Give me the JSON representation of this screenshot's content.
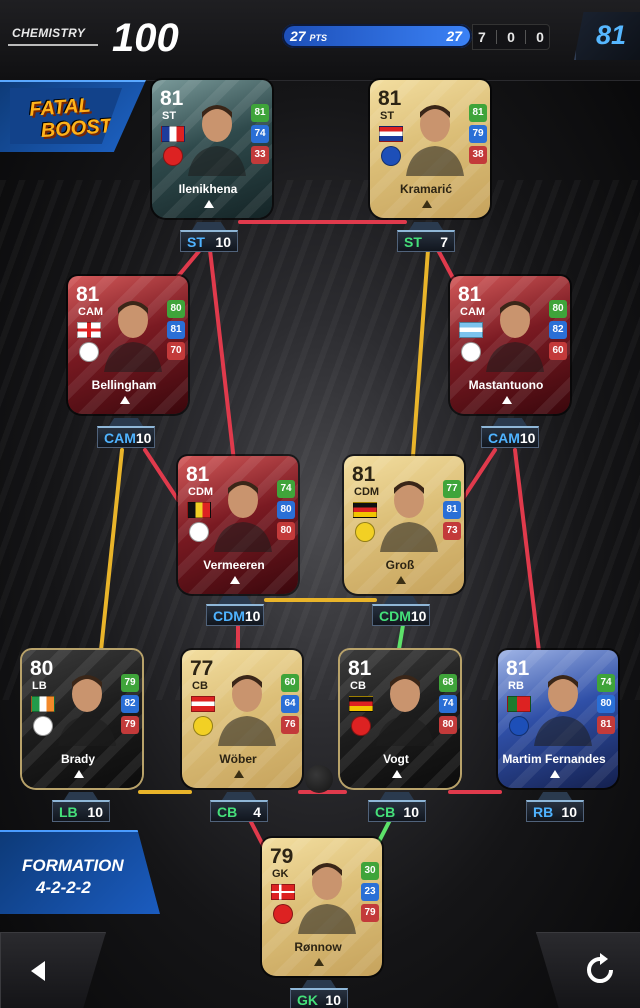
{
  "topbar": {
    "chemistry_label": "CHEMISTRY",
    "chemistry_value": "100",
    "points_value": "27",
    "points_unit": "PTS",
    "points_right": "27",
    "score": [
      "7",
      "0",
      "0"
    ],
    "team_rating": "81"
  },
  "badge": {
    "line1": "FATAL",
    "line2": "BOOST"
  },
  "formation": {
    "label": "FORMATION",
    "value": "4-2-2-2"
  },
  "colors": {
    "gold_link": "#e9b42a",
    "red_link": "#e03a4c",
    "green_link": "#5de26a",
    "chip_blue": "#4fb3ff",
    "chip_green": "#45e07a"
  },
  "players": [
    {
      "name": "Ilenikhena",
      "ovr": "81",
      "pos": "ST",
      "stats": [
        "81",
        "74",
        "33"
      ],
      "flag": "France",
      "club": "Monaco",
      "style": "teal",
      "chip_pos": "ST",
      "chip_val": "10",
      "chip_color": "blue"
    },
    {
      "name": "Kramarić",
      "ovr": "81",
      "pos": "ST",
      "stats": [
        "81",
        "79",
        "38"
      ],
      "flag": "Croatia",
      "club": "Hoffenheim",
      "style": "gold",
      "chip_pos": "ST",
      "chip_val": "7",
      "chip_color": "green"
    },
    {
      "name": "Bellingham",
      "ovr": "81",
      "pos": "CAM",
      "stats": [
        "80",
        "81",
        "70"
      ],
      "flag": "England",
      "club": "Southampton",
      "style": "red",
      "chip_pos": "CAM",
      "chip_val": "10",
      "chip_color": "blue"
    },
    {
      "name": "Mastantuono",
      "ovr": "81",
      "pos": "CAM",
      "stats": [
        "80",
        "82",
        "60"
      ],
      "flag": "Argentina",
      "club": "River Plate",
      "style": "red",
      "chip_pos": "CAM",
      "chip_val": "10",
      "chip_color": "blue"
    },
    {
      "name": "Vermeeren",
      "ovr": "81",
      "pos": "CDM",
      "stats": [
        "74",
        "80",
        "80"
      ],
      "flag": "Belgium",
      "club": "Leipzig",
      "style": "red",
      "chip_pos": "CDM",
      "chip_val": "10",
      "chip_color": "blue"
    },
    {
      "name": "Groß",
      "ovr": "81",
      "pos": "CDM",
      "stats": [
        "77",
        "81",
        "73"
      ],
      "flag": "Germany",
      "club": "Dortmund",
      "style": "gold",
      "chip_pos": "CDM",
      "chip_val": "10",
      "chip_color": "green"
    },
    {
      "name": "Brady",
      "ovr": "80",
      "pos": "LB",
      "stats": [
        "79",
        "82",
        "79"
      ],
      "flag": "Ireland",
      "club": "Preston",
      "style": "dark",
      "chip_pos": "LB",
      "chip_val": "10",
      "chip_color": "green"
    },
    {
      "name": "Wöber",
      "ovr": "77",
      "pos": "CB",
      "stats": [
        "60",
        "64",
        "76"
      ],
      "flag": "Austria",
      "club": "Leeds",
      "style": "gold",
      "chip_pos": "CB",
      "chip_val": "4",
      "chip_color": "green"
    },
    {
      "name": "Vogt",
      "ovr": "81",
      "pos": "CB",
      "stats": [
        "68",
        "74",
        "80"
      ],
      "flag": "Germany",
      "club": "Union",
      "style": "dark",
      "chip_pos": "CB",
      "chip_val": "10",
      "chip_color": "green"
    },
    {
      "name": "Martim Fernandes",
      "ovr": "81",
      "pos": "RB",
      "stats": [
        "74",
        "80",
        "81"
      ],
      "flag": "Portugal",
      "club": "Porto",
      "style": "blue",
      "chip_pos": "RB",
      "chip_val": "10",
      "chip_color": "blue"
    },
    {
      "name": "Rønnow",
      "ovr": "79",
      "pos": "GK",
      "stats": [
        "30",
        "23",
        "79"
      ],
      "flag": "Denmark",
      "club": "Union",
      "style": "gold",
      "chip_pos": "GK",
      "chip_val": "10",
      "chip_color": "green"
    }
  ]
}
